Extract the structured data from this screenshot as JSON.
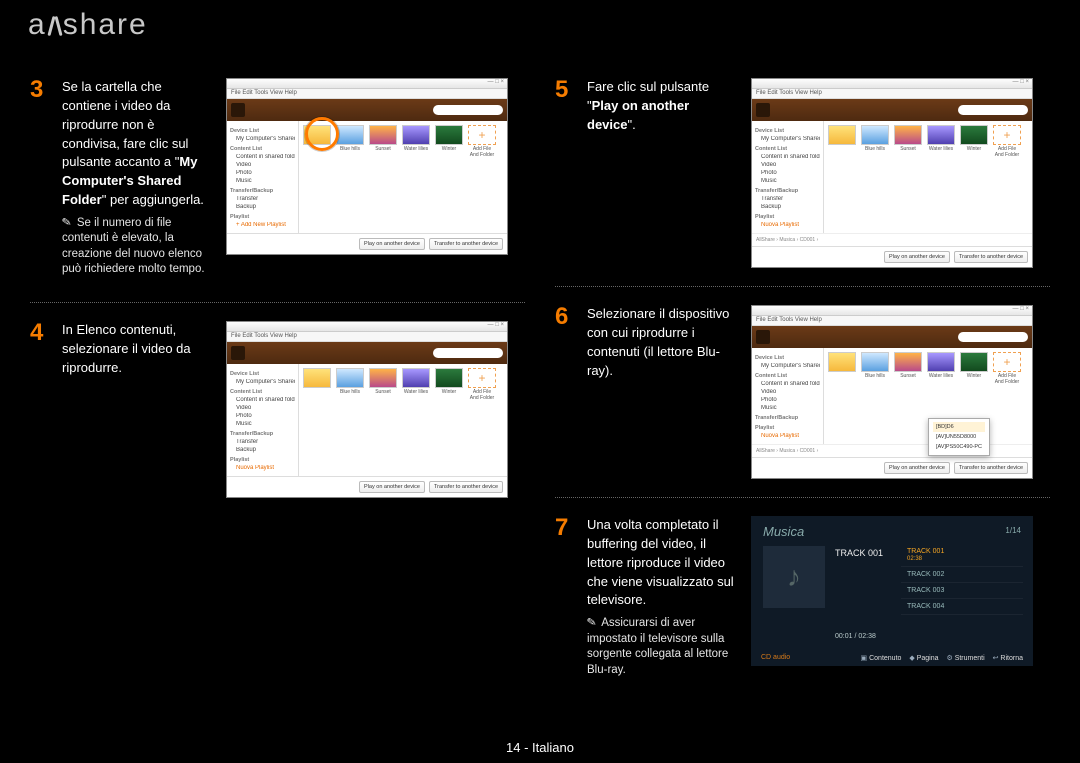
{
  "logo_left": "a",
  "logo_right": "share",
  "page_footer": "14 - Italiano",
  "app_menus": "File   Edit   Tools   View   Help",
  "app_bottom_buttons": {
    "play": "Play on another device",
    "transfer": "Transfer to another device"
  },
  "sidebar": {
    "header1": "Device List",
    "item_mycomp": "My Computer's Shared folder",
    "header2": "Content List",
    "item_contentshare": "Content in shared folders",
    "item_video": "Video",
    "item_photo": "Photo",
    "item_music": "Music",
    "header3": "Transfer/Backup",
    "item_transfer": "Transfer",
    "item_backup": "Backup",
    "header4": "Playlist",
    "item_newplaylist": "+ Add New Playlist",
    "item_savedlist": "Nuova Playlist"
  },
  "thumb_labels": {
    "folder": "",
    "bluehills": "Blue hills",
    "sunset": "Sunset",
    "waterlilies": "Water lilies",
    "winter": "Winter",
    "addfile": "Add File And Folder"
  },
  "statusline_5": "AllShare › Musica › CD001 ›",
  "statusline_6": "AllShare › Musica › CD001 ›",
  "popup6": {
    "device1": "[BD]D6",
    "device2": "[AV]UN55D8000",
    "device3": "[AV]PS50C490-PC"
  },
  "steps": {
    "s3": {
      "num": "3",
      "text_a": "Se la cartella che contiene i video da riprodurre non è condivisa, fare clic sul pulsante accanto a \"",
      "text_b_bold": "My Computer's Shared Folder",
      "text_c": "\" per aggiungerla.",
      "note": "Se il numero di file contenuti è elevato, la creazione del nuovo elenco può richiedere molto tempo."
    },
    "s4": {
      "num": "4",
      "text": "In Elenco contenuti, selezionare il video da riprodurre."
    },
    "s5": {
      "num": "5",
      "text_a": "Fare clic sul pulsante \"",
      "text_b_bold": "Play on another device",
      "text_c": "\"."
    },
    "s6": {
      "num": "6",
      "text": "Selezionare il dispositivo con cui riprodurre i contenuti (il lettore Blu-ray)."
    },
    "s7": {
      "num": "7",
      "text": "Una volta completato il buffering del video, il lettore riproduce il video che viene visualizzato sul televisore.",
      "note": "Assicurarsi di aver impostato il televisore sulla sorgente collegata al lettore Blu-ray."
    }
  },
  "tv": {
    "title": "Musica",
    "count": "1/14",
    "nowplaying": "TRACK 001",
    "time": "00:01 / 02:38",
    "tracks": {
      "t1": "TRACK 001",
      "t1sub": "02:38",
      "t2": "TRACK 002",
      "t3": "TRACK 003",
      "t4": "TRACK 004"
    },
    "footer_left": "CD audio",
    "footer_r1": "Contenuto",
    "footer_r2": "Pagina",
    "footer_r3": "Strumenti",
    "footer_r4": "Ritorna"
  }
}
